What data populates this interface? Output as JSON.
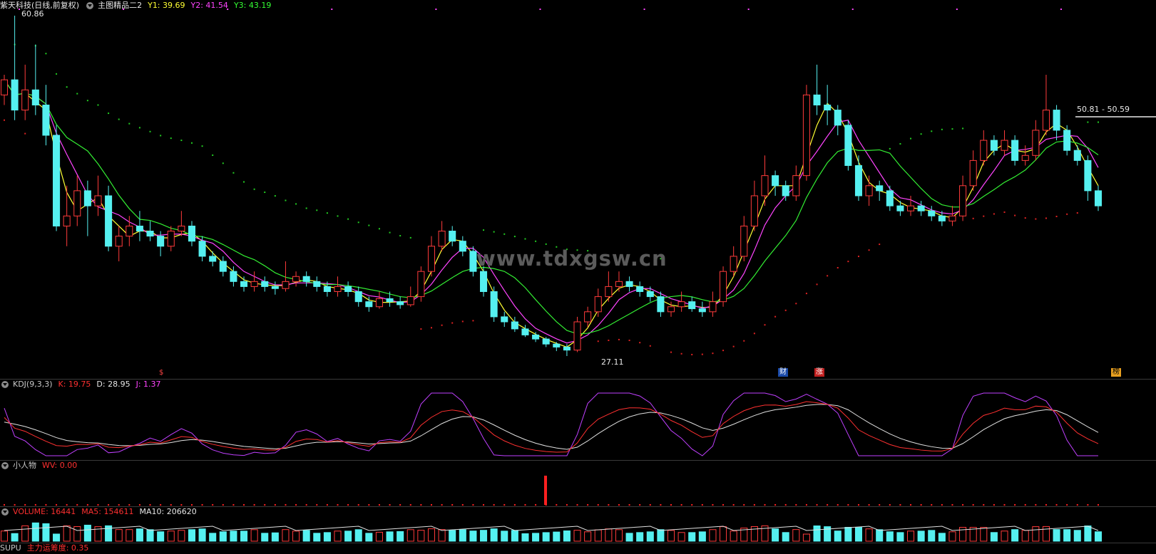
{
  "header": {
    "stock_name": "紫天科技(日线,前复权)",
    "indicator": "主图精品二2",
    "y1": "Y1: 39.69",
    "y2": "Y2: 41.54",
    "y3": "Y3: 43.19"
  },
  "annotations": {
    "high_label": "60.86",
    "low_label": "27.11",
    "range_label": "50.81 - 50.59",
    "watermark": "www.tdxgsw.cn",
    "badge_s": "$",
    "badge_cai": "财",
    "badge_zhang": "涨",
    "badge_bang": "榜"
  },
  "kdj": {
    "title": "KDJ(9,3,3)",
    "k": "K: 19.75",
    "d": "D: 28.95",
    "j": "J: 1.37"
  },
  "xiaorenwu": {
    "title": "小人物",
    "wv": "WV: 0.00"
  },
  "volume": {
    "title": "VOLUME: 16441",
    "ma5": "MA5: 154611",
    "ma10": "MA10: 206620"
  },
  "bottom": {
    "title": "SUPU",
    "value": "主力运筹度: 0.35"
  },
  "colors": {
    "up": "#ff3b3b",
    "down": "#55f0f0",
    "ma_yellow": "#ffff33",
    "ma_magenta": "#ff44ff",
    "ma_green": "#33ee33",
    "kdj_k": "#ff3030",
    "kdj_d": "#e0e0e0",
    "kdj_j": "#c040ff"
  },
  "chart_data": {
    "type": "candlestick",
    "ylim": [
      27.11,
      60.86
    ],
    "candles": [
      [
        53.0,
        54.5,
        55.0,
        52.0
      ],
      [
        54.5,
        51.5,
        60.86,
        50.5
      ],
      [
        51.5,
        53.5,
        56.0,
        50.5
      ],
      [
        53.5,
        52.0,
        58.0,
        51.0
      ],
      [
        52.0,
        49.0,
        54.0,
        48.0
      ],
      [
        49.0,
        40.0,
        50.0,
        39.5
      ],
      [
        40.0,
        41.0,
        44.0,
        38.0
      ],
      [
        41.0,
        43.5,
        45.0,
        40.0
      ],
      [
        43.5,
        42.0,
        44.5,
        39.0
      ],
      [
        42.0,
        43.0,
        45.0,
        41.0
      ],
      [
        43.0,
        38.0,
        44.0,
        37.5
      ],
      [
        38.0,
        39.0,
        40.0,
        36.5
      ],
      [
        39.0,
        40.0,
        41.0,
        38.0
      ],
      [
        40.0,
        39.5,
        41.5,
        38.5
      ],
      [
        39.5,
        39.0,
        40.5,
        38.5
      ],
      [
        39.0,
        38.0,
        39.5,
        37.0
      ],
      [
        38.0,
        39.5,
        40.0,
        37.5
      ],
      [
        39.5,
        40.0,
        41.5,
        39.0
      ],
      [
        40.0,
        38.5,
        40.5,
        38.0
      ],
      [
        38.5,
        37.0,
        39.0,
        36.5
      ],
      [
        37.0,
        36.5,
        37.5,
        36.0
      ],
      [
        36.5,
        35.5,
        37.0,
        35.0
      ],
      [
        35.5,
        34.5,
        36.0,
        34.0
      ],
      [
        34.5,
        34.0,
        35.0,
        33.5
      ],
      [
        34.0,
        34.5,
        35.5,
        33.5
      ],
      [
        34.5,
        34.0,
        35.0,
        33.5
      ],
      [
        34.0,
        33.8,
        34.5,
        33.2
      ],
      [
        33.8,
        34.5,
        36.5,
        33.5
      ],
      [
        34.5,
        35.0,
        35.5,
        34.0
      ],
      [
        35.0,
        34.5,
        35.5,
        34.0
      ],
      [
        34.5,
        34.0,
        35.0,
        33.5
      ],
      [
        34.0,
        33.5,
        34.5,
        33.0
      ],
      [
        33.5,
        34.0,
        35.0,
        33.0
      ],
      [
        34.0,
        33.5,
        34.5,
        33.0
      ],
      [
        33.5,
        32.5,
        34.0,
        32.0
      ],
      [
        32.5,
        32.0,
        33.0,
        31.5
      ],
      [
        32.0,
        32.8,
        33.5,
        31.8
      ],
      [
        32.8,
        32.5,
        33.5,
        32.0
      ],
      [
        32.5,
        32.2,
        33.0,
        31.8
      ],
      [
        32.2,
        33.0,
        34.0,
        32.0
      ],
      [
        33.0,
        35.5,
        36.0,
        32.5
      ],
      [
        35.5,
        38.0,
        39.0,
        35.0
      ],
      [
        38.0,
        39.5,
        40.5,
        37.5
      ],
      [
        39.5,
        38.5,
        40.0,
        38.0
      ],
      [
        38.5,
        37.5,
        39.0,
        37.0
      ],
      [
        37.5,
        35.5,
        38.0,
        35.0
      ],
      [
        35.5,
        33.5,
        36.0,
        33.0
      ],
      [
        33.5,
        31.0,
        34.0,
        30.5
      ],
      [
        31.0,
        30.5,
        31.5,
        30.0
      ],
      [
        30.5,
        29.8,
        31.0,
        29.5
      ],
      [
        29.8,
        29.2,
        30.2,
        29.0
      ],
      [
        29.2,
        28.8,
        29.5,
        28.5
      ],
      [
        28.8,
        28.3,
        29.0,
        28.0
      ],
      [
        28.3,
        28.0,
        28.5,
        27.6
      ],
      [
        28.0,
        27.7,
        28.3,
        27.11
      ],
      [
        27.7,
        30.5,
        31.0,
        27.5
      ],
      [
        30.5,
        31.5,
        32.0,
        30.0
      ],
      [
        31.5,
        33.0,
        33.8,
        31.0
      ],
      [
        33.0,
        34.0,
        35.5,
        32.5
      ],
      [
        34.0,
        34.5,
        35.5,
        33.5
      ],
      [
        34.5,
        34.0,
        35.0,
        33.5
      ],
      [
        34.0,
        33.5,
        34.5,
        33.0
      ],
      [
        33.5,
        33.0,
        34.0,
        32.5
      ],
      [
        33.0,
        31.5,
        33.5,
        31.0
      ],
      [
        31.5,
        32.0,
        32.5,
        31.0
      ],
      [
        32.0,
        32.5,
        33.5,
        31.5
      ],
      [
        32.5,
        31.8,
        33.0,
        31.5
      ],
      [
        31.8,
        31.5,
        32.5,
        31.0
      ],
      [
        31.5,
        32.5,
        33.5,
        31.0
      ],
      [
        32.5,
        35.5,
        36.0,
        32.0
      ],
      [
        35.5,
        37.0,
        38.0,
        35.0
      ],
      [
        37.0,
        40.0,
        41.0,
        36.5
      ],
      [
        40.0,
        43.0,
        44.5,
        39.5
      ],
      [
        43.0,
        45.0,
        47.0,
        42.0
      ],
      [
        45.0,
        44.0,
        45.5,
        43.0
      ],
      [
        44.0,
        43.0,
        44.5,
        42.5
      ],
      [
        43.0,
        45.0,
        46.0,
        42.5
      ],
      [
        45.0,
        53.0,
        54.0,
        44.5
      ],
      [
        53.0,
        52.0,
        56.0,
        51.0
      ],
      [
        52.0,
        51.5,
        54.0,
        50.0
      ],
      [
        51.5,
        50.0,
        52.0,
        49.0
      ],
      [
        50.0,
        46.0,
        50.5,
        45.5
      ],
      [
        46.0,
        43.0,
        47.0,
        42.5
      ],
      [
        43.0,
        44.0,
        45.0,
        42.0
      ],
      [
        44.0,
        43.5,
        44.5,
        42.5
      ],
      [
        43.5,
        42.0,
        44.0,
        41.5
      ],
      [
        42.0,
        41.5,
        42.5,
        41.0
      ],
      [
        41.5,
        42.0,
        43.0,
        41.0
      ],
      [
        42.0,
        41.5,
        42.5,
        41.0
      ],
      [
        41.5,
        41.0,
        42.0,
        40.5
      ],
      [
        41.0,
        40.5,
        41.5,
        40.0
      ],
      [
        40.5,
        41.0,
        42.0,
        40.0
      ],
      [
        41.0,
        44.0,
        45.0,
        40.5
      ],
      [
        44.0,
        46.5,
        47.5,
        43.5
      ],
      [
        46.5,
        48.5,
        49.5,
        46.0
      ],
      [
        48.5,
        47.5,
        49.0,
        47.0
      ],
      [
        47.5,
        48.5,
        49.5,
        47.0
      ],
      [
        48.5,
        46.5,
        49.0,
        46.0
      ],
      [
        46.5,
        47.0,
        48.0,
        46.0
      ],
      [
        47.0,
        49.5,
        50.5,
        46.5
      ],
      [
        49.5,
        51.5,
        55.0,
        49.0
      ],
      [
        51.5,
        49.5,
        52.0,
        48.5
      ],
      [
        49.5,
        47.5,
        50.0,
        47.0
      ],
      [
        47.5,
        46.5,
        48.0,
        46.0
      ],
      [
        46.5,
        43.5,
        47.0,
        42.5
      ],
      [
        43.5,
        42.0,
        44.0,
        41.5
      ]
    ],
    "kdj_k_last": 19.75,
    "kdj_d_last": 28.95,
    "kdj_j_last": 1.37,
    "volume_last": 16441,
    "volume_ma5": 154611,
    "volume_ma10": 206620,
    "wv": 0.0,
    "supu_value": 0.35
  }
}
